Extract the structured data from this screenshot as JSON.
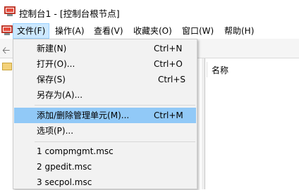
{
  "window": {
    "title": "控制台1 - [控制台根节点]"
  },
  "menubar": {
    "items": [
      {
        "label": "文件(F)",
        "active": true
      },
      {
        "label": "操作(A)",
        "active": false
      },
      {
        "label": "查看(V)",
        "active": false
      },
      {
        "label": "收藏夹(O)",
        "active": false
      },
      {
        "label": "窗口(W)",
        "active": false
      },
      {
        "label": "帮助(H)",
        "active": false
      }
    ]
  },
  "file_menu": {
    "items": [
      {
        "label": "新建(N)",
        "shortcut": "Ctrl+N"
      },
      {
        "label": "打开(O)...",
        "shortcut": "Ctrl+O"
      },
      {
        "label": "保存(S)",
        "shortcut": "Ctrl+S"
      },
      {
        "label": "另存为(A)...",
        "shortcut": ""
      },
      {
        "label": "添加/删除管理单元(M)...",
        "shortcut": "Ctrl+M",
        "highlighted": true
      },
      {
        "label": "选项(P)...",
        "shortcut": ""
      },
      {
        "label": "1 compmgmt.msc",
        "shortcut": ""
      },
      {
        "label": "2 gpedit.msc",
        "shortcut": ""
      },
      {
        "label": "3 secpol.msc",
        "shortcut": ""
      }
    ]
  },
  "right_pane": {
    "column_header": "名称"
  },
  "icons": {
    "app": "mmc-console-icon",
    "back": "back-arrow-icon",
    "folder": "folder-icon"
  },
  "colors": {
    "highlight": "#91c9f7",
    "menu_active": "#cce8ff",
    "menu_bg": "#f2f2f2"
  }
}
